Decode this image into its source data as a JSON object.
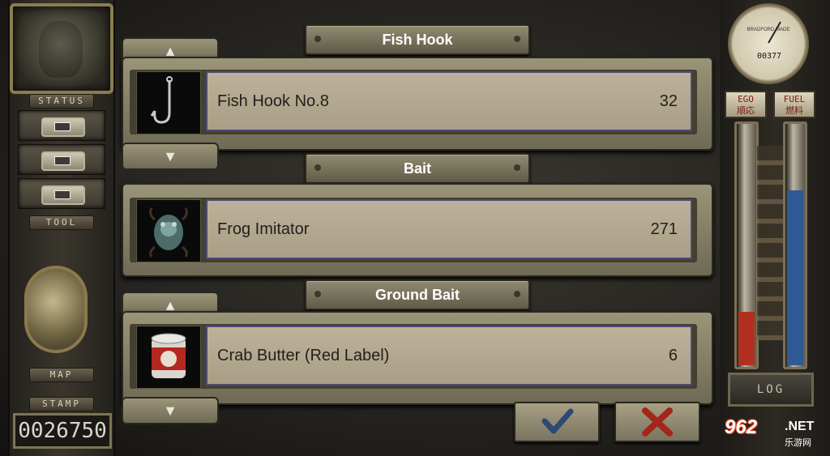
{
  "left_panel": {
    "status_label": "STATUS",
    "tool_label": "TOOL",
    "map_label": "MAP",
    "stamp_label": "STAMP",
    "stamp_count": "0026750"
  },
  "right_panel": {
    "dial_title": "BRADFORD MADE",
    "dial_digits": "00377",
    "ego_label": "EGO",
    "ego_cn": "順応",
    "fuel_label": "FUEL",
    "fuel_cn": "燃料",
    "ego_level": 0.22,
    "fuel_level": 0.72,
    "log_label": "LOG"
  },
  "sections": [
    {
      "title": "Fish Hook",
      "item_name": "Fish Hook No.8",
      "count": "32"
    },
    {
      "title": "Bait",
      "item_name": "Frog Imitator",
      "count": "271"
    },
    {
      "title": "Ground Bait",
      "item_name": "Crab Butter (Red Label)",
      "count": "6"
    }
  ],
  "arrows": {
    "up": "▲",
    "down": "▼"
  },
  "watermark": {
    "number": "962",
    "suffix": ".NET",
    "cn": "乐游网"
  },
  "colors": {
    "confirm": "#2c4a72",
    "cancel": "#a3261a",
    "ego_fill": "#b2301f",
    "fuel_fill": "#2f5a96"
  }
}
